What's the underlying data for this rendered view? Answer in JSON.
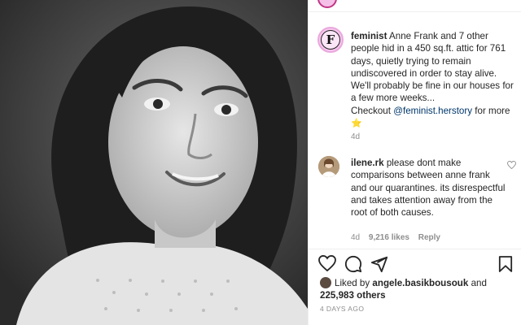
{
  "post": {
    "username": "feminist",
    "avatar_letter": "F",
    "caption": "Anne Frank and 7 other people hid in a 450 sq.ft. attic for 761 days, quietly trying to remain undiscovered in order to stay alive. We'll probably be fine in our houses for a few more weeks...",
    "checkout_prefix": "Checkout",
    "mention": "@feminist.herstory",
    "checkout_suffix": "for more",
    "star": "⭐",
    "time_ago": "4d",
    "date": "4 DAYS AGO"
  },
  "comment": {
    "username": "ilene.rk",
    "text": "please dont make comparisons between anne frank and our quarantines. its disrespectful and takes attention away from the root of both causes.",
    "time_ago": "4d",
    "likes": "9,216 likes",
    "reply_label": "Reply"
  },
  "likes": {
    "prefix": "Liked by",
    "user": "angele.basikbousouk",
    "and": "and",
    "count": "225,983 others"
  },
  "icons": {
    "like": "heart-icon",
    "comment": "comment-icon",
    "share": "paper-plane-icon",
    "save": "bookmark-icon"
  },
  "colors": {
    "mention": "#00376b",
    "meta": "#8e8e8e",
    "avatar_ring": "#e9a9dd"
  }
}
